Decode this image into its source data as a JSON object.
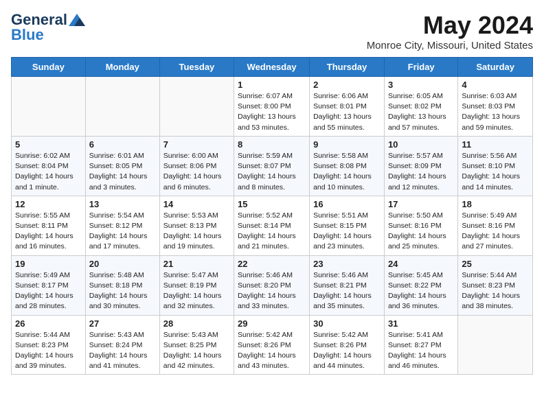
{
  "logo": {
    "general": "General",
    "blue": "Blue"
  },
  "title": "May 2024",
  "location": "Monroe City, Missouri, United States",
  "days_of_week": [
    "Sunday",
    "Monday",
    "Tuesday",
    "Wednesday",
    "Thursday",
    "Friday",
    "Saturday"
  ],
  "weeks": [
    [
      {
        "day": "",
        "info": ""
      },
      {
        "day": "",
        "info": ""
      },
      {
        "day": "",
        "info": ""
      },
      {
        "day": "1",
        "info": "Sunrise: 6:07 AM\nSunset: 8:00 PM\nDaylight: 13 hours\nand 53 minutes."
      },
      {
        "day": "2",
        "info": "Sunrise: 6:06 AM\nSunset: 8:01 PM\nDaylight: 13 hours\nand 55 minutes."
      },
      {
        "day": "3",
        "info": "Sunrise: 6:05 AM\nSunset: 8:02 PM\nDaylight: 13 hours\nand 57 minutes."
      },
      {
        "day": "4",
        "info": "Sunrise: 6:03 AM\nSunset: 8:03 PM\nDaylight: 13 hours\nand 59 minutes."
      }
    ],
    [
      {
        "day": "5",
        "info": "Sunrise: 6:02 AM\nSunset: 8:04 PM\nDaylight: 14 hours\nand 1 minute."
      },
      {
        "day": "6",
        "info": "Sunrise: 6:01 AM\nSunset: 8:05 PM\nDaylight: 14 hours\nand 3 minutes."
      },
      {
        "day": "7",
        "info": "Sunrise: 6:00 AM\nSunset: 8:06 PM\nDaylight: 14 hours\nand 6 minutes."
      },
      {
        "day": "8",
        "info": "Sunrise: 5:59 AM\nSunset: 8:07 PM\nDaylight: 14 hours\nand 8 minutes."
      },
      {
        "day": "9",
        "info": "Sunrise: 5:58 AM\nSunset: 8:08 PM\nDaylight: 14 hours\nand 10 minutes."
      },
      {
        "day": "10",
        "info": "Sunrise: 5:57 AM\nSunset: 8:09 PM\nDaylight: 14 hours\nand 12 minutes."
      },
      {
        "day": "11",
        "info": "Sunrise: 5:56 AM\nSunset: 8:10 PM\nDaylight: 14 hours\nand 14 minutes."
      }
    ],
    [
      {
        "day": "12",
        "info": "Sunrise: 5:55 AM\nSunset: 8:11 PM\nDaylight: 14 hours\nand 16 minutes."
      },
      {
        "day": "13",
        "info": "Sunrise: 5:54 AM\nSunset: 8:12 PM\nDaylight: 14 hours\nand 17 minutes."
      },
      {
        "day": "14",
        "info": "Sunrise: 5:53 AM\nSunset: 8:13 PM\nDaylight: 14 hours\nand 19 minutes."
      },
      {
        "day": "15",
        "info": "Sunrise: 5:52 AM\nSunset: 8:14 PM\nDaylight: 14 hours\nand 21 minutes."
      },
      {
        "day": "16",
        "info": "Sunrise: 5:51 AM\nSunset: 8:15 PM\nDaylight: 14 hours\nand 23 minutes."
      },
      {
        "day": "17",
        "info": "Sunrise: 5:50 AM\nSunset: 8:16 PM\nDaylight: 14 hours\nand 25 minutes."
      },
      {
        "day": "18",
        "info": "Sunrise: 5:49 AM\nSunset: 8:16 PM\nDaylight: 14 hours\nand 27 minutes."
      }
    ],
    [
      {
        "day": "19",
        "info": "Sunrise: 5:49 AM\nSunset: 8:17 PM\nDaylight: 14 hours\nand 28 minutes."
      },
      {
        "day": "20",
        "info": "Sunrise: 5:48 AM\nSunset: 8:18 PM\nDaylight: 14 hours\nand 30 minutes."
      },
      {
        "day": "21",
        "info": "Sunrise: 5:47 AM\nSunset: 8:19 PM\nDaylight: 14 hours\nand 32 minutes."
      },
      {
        "day": "22",
        "info": "Sunrise: 5:46 AM\nSunset: 8:20 PM\nDaylight: 14 hours\nand 33 minutes."
      },
      {
        "day": "23",
        "info": "Sunrise: 5:46 AM\nSunset: 8:21 PM\nDaylight: 14 hours\nand 35 minutes."
      },
      {
        "day": "24",
        "info": "Sunrise: 5:45 AM\nSunset: 8:22 PM\nDaylight: 14 hours\nand 36 minutes."
      },
      {
        "day": "25",
        "info": "Sunrise: 5:44 AM\nSunset: 8:23 PM\nDaylight: 14 hours\nand 38 minutes."
      }
    ],
    [
      {
        "day": "26",
        "info": "Sunrise: 5:44 AM\nSunset: 8:23 PM\nDaylight: 14 hours\nand 39 minutes."
      },
      {
        "day": "27",
        "info": "Sunrise: 5:43 AM\nSunset: 8:24 PM\nDaylight: 14 hours\nand 41 minutes."
      },
      {
        "day": "28",
        "info": "Sunrise: 5:43 AM\nSunset: 8:25 PM\nDaylight: 14 hours\nand 42 minutes."
      },
      {
        "day": "29",
        "info": "Sunrise: 5:42 AM\nSunset: 8:26 PM\nDaylight: 14 hours\nand 43 minutes."
      },
      {
        "day": "30",
        "info": "Sunrise: 5:42 AM\nSunset: 8:26 PM\nDaylight: 14 hours\nand 44 minutes."
      },
      {
        "day": "31",
        "info": "Sunrise: 5:41 AM\nSunset: 8:27 PM\nDaylight: 14 hours\nand 46 minutes."
      },
      {
        "day": "",
        "info": ""
      }
    ]
  ]
}
